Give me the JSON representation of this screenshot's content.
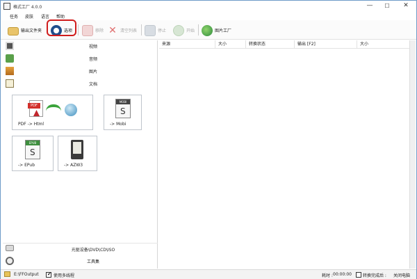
{
  "window": {
    "title": "格式工厂 4.0.0",
    "minimize": "—",
    "maximize": "☐",
    "close": "✕"
  },
  "menu": {
    "items": [
      "任务",
      "皮肤",
      "语言",
      "帮助"
    ]
  },
  "toolbar": {
    "output_folder": "输出文件夹",
    "options": "选项",
    "remove": "移除",
    "clear_list": "清空列表",
    "stop": "停止",
    "start": "开始",
    "photo_factory": "图片工厂"
  },
  "categories": {
    "video": "视频",
    "audio": "音频",
    "image": "图片",
    "document": "文档",
    "disc": "光驱设备\\DVD\\CD\\ISO",
    "tools": "工具集"
  },
  "tiles": [
    {
      "label": "PDF -> Html",
      "icon": "pdf-to-html-icon"
    },
    {
      "label": "-> Mobi",
      "icon": "mobi-icon"
    },
    {
      "label": "-> EPub",
      "icon": "epub-icon"
    },
    {
      "label": "-> AZW3",
      "icon": "kindle-icon"
    }
  ],
  "task_list": {
    "columns": [
      "来源",
      "大小",
      "转换状态",
      "输出 [F2]",
      "大小"
    ]
  },
  "status": {
    "output_path": "E:\\FFOutput",
    "multithread": "使用多线程",
    "elapsed_label": "耗时 :",
    "elapsed_value": "00:00:00",
    "after_convert": "转换完成后 :",
    "shutdown": "关闭电脑"
  },
  "colors": {
    "highlight_ring": "#d01c1c",
    "window_border": "#6d9bc8"
  }
}
